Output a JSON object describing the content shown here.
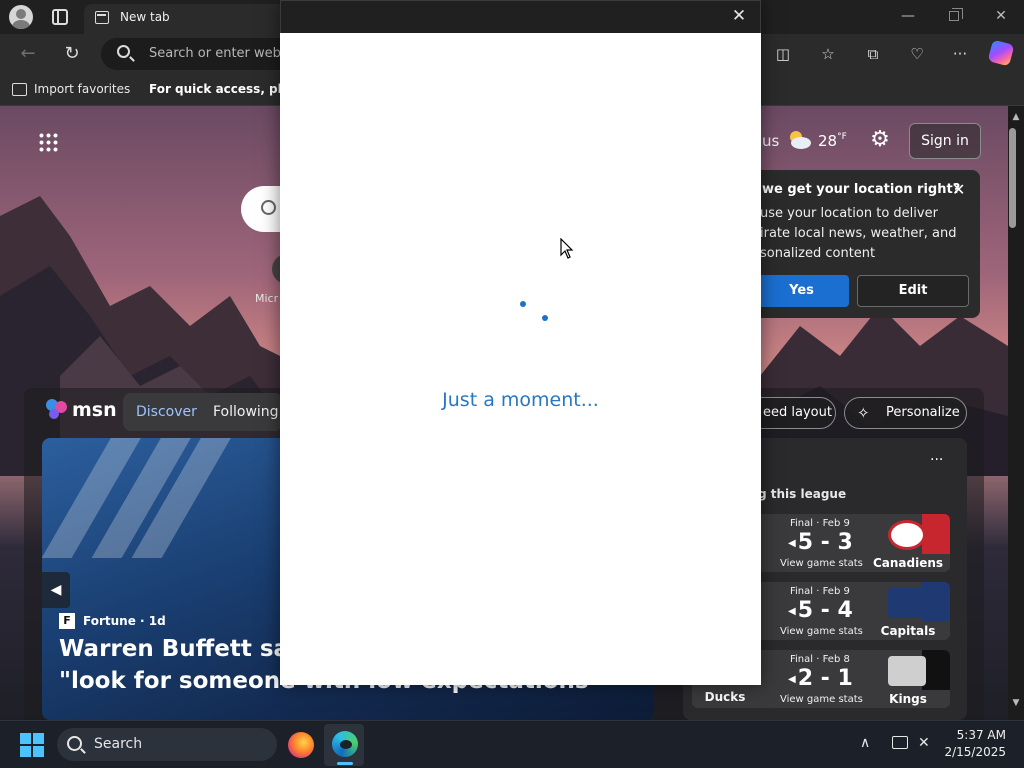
{
  "browser": {
    "tab_title": "New tab",
    "address_placeholder": "Search or enter web a",
    "favorites": {
      "import_label": "Import favorites",
      "hint": "For quick access, place y"
    }
  },
  "ntp": {
    "ms_label": "Micr",
    "weather": {
      "location": "us",
      "temp": "28",
      "unit": "°F"
    },
    "sign_in": "Sign in",
    "location_card": {
      "title": "we get your location right?",
      "body": "use your location to deliver irate local news, weather, and sonalized content",
      "yes": "Yes",
      "edit": "Edit"
    },
    "msn": {
      "logo_text": "msn",
      "tabs": [
        "Discover",
        "Following"
      ],
      "feed_layout": "eed layout",
      "personalize": "Personalize"
    },
    "hero": {
      "source_icon": "F",
      "source": "Fortune · 1d",
      "headline_line1": "Warren Buffett says",
      "headline_line2": "\"look for someone with low expectations"
    },
    "sports": {
      "more": "···",
      "league_label": "g this league",
      "games": [
        {
          "status": "Final · Feb 9",
          "score": "5 - 3",
          "stats": "View game stats",
          "team": "Canadiens",
          "away": ""
        },
        {
          "status": "Final · Feb 9",
          "score": "5 - 4",
          "stats": "View game stats",
          "team": "Capitals",
          "away": ""
        },
        {
          "status": "Final · Feb 8",
          "score": "2 - 1",
          "stats": "View game stats",
          "team": "Kings",
          "away": "Ducks"
        }
      ]
    }
  },
  "modal": {
    "close": "✕",
    "message": "Just a moment..."
  },
  "taskbar": {
    "search_label": "Search",
    "time": "5:37 AM",
    "date": "2/15/2025"
  },
  "colors": {
    "accent_blue": "#1b6fd1",
    "modal_text": "#2777c2",
    "spinner": "#1e71c7",
    "msn_discover": "#9cc3ff"
  },
  "icons": [
    "profile-icon",
    "tabs-icon",
    "back-icon",
    "refresh-icon",
    "search-icon",
    "split-screen-icon",
    "favorites-icon",
    "collections-icon",
    "performance-icon",
    "more-icon",
    "copilot-icon",
    "apps-grid-icon",
    "gear-icon",
    "weather-icon",
    "close-icon",
    "windows-start-icon",
    "firefox-icon",
    "edge-icon",
    "chevron-up-icon",
    "network-icon",
    "volume-icon"
  ]
}
